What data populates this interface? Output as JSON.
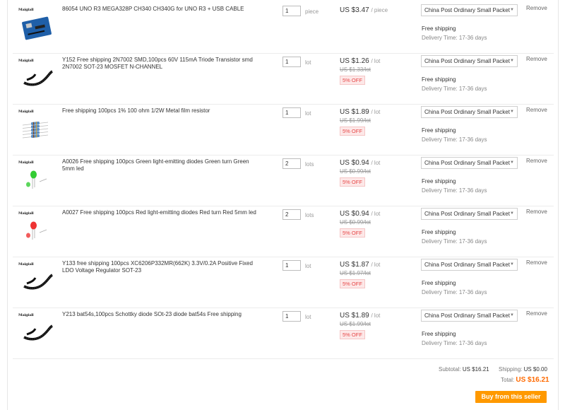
{
  "items": [
    {
      "brand": "Maigiall",
      "title": "86054 UNO R3 MEGA328P CH340 CH340G for UNO R3 + USB CABLE",
      "qty": "1",
      "unit": "piece",
      "price": "US $3.47",
      "per": "/ piece",
      "old_price": "",
      "discount": "",
      "shipping": "China Post Ordinary Small Packet",
      "free": "Free shipping",
      "delivery": "Delivery Time: 17-36 days",
      "remove": "Remove",
      "icon": "arduino-board"
    },
    {
      "brand": "Maigiall",
      "title": "Y152 Free shipping 2N7002 SMD,100pcs 60V 115mA Triode Transistor smd 2N7002 SOT-23 MOSFET N-CHANNEL",
      "qty": "1",
      "unit": "lot",
      "price": "US $1.26",
      "per": "/ lot",
      "old_price": "US $1.33/lot",
      "discount": "5% OFF",
      "shipping": "China Post Ordinary Small Packet",
      "free": "Free shipping",
      "delivery": "Delivery Time: 17-36 days",
      "remove": "Remove",
      "icon": "smd-tape"
    },
    {
      "brand": "Maigiall",
      "title": "Free shipping 100pcs 1% 100 ohm 1/2W Metal film resistor",
      "qty": "1",
      "unit": "lot",
      "price": "US $1.89",
      "per": "/ lot",
      "old_price": "US $1.99/lot",
      "discount": "5% OFF",
      "shipping": "China Post Ordinary Small Packet",
      "free": "Free shipping",
      "delivery": "Delivery Time: 17-36 days",
      "remove": "Remove",
      "icon": "resistors"
    },
    {
      "brand": "Maigiall",
      "title": "A0026 Free shipping 100pcs Green light-emitting diodes Green turn Green 5mm led",
      "qty": "2",
      "unit": "lots",
      "price": "US $0.94",
      "per": "/ lot",
      "old_price": "US $0.99/lot",
      "discount": "5% OFF",
      "shipping": "China Post Ordinary Small Packet",
      "free": "Free shipping",
      "delivery": "Delivery Time: 17-36 days",
      "remove": "Remove",
      "icon": "green-led",
      "led_color": "#33cc33"
    },
    {
      "brand": "Maigiall",
      "title": "A0027 Free shipping 100pcs Red light-emitting diodes Red turn Red 5mm led",
      "qty": "2",
      "unit": "lots",
      "price": "US $0.94",
      "per": "/ lot",
      "old_price": "US $0.99/lot",
      "discount": "5% OFF",
      "shipping": "China Post Ordinary Small Packet",
      "free": "Free shipping",
      "delivery": "Delivery Time: 17-36 days",
      "remove": "Remove",
      "icon": "red-led",
      "led_color": "#ee3333"
    },
    {
      "brand": "Maigiall",
      "title": "Y133 free shipping 100pcs XC6206P332MR(662K) 3.3V/0.2A Positive Fixed LDO Voltage Regulator SOT-23",
      "qty": "1",
      "unit": "lot",
      "price": "US $1.87",
      "per": "/ lot",
      "old_price": "US $1.97/lot",
      "discount": "5% OFF",
      "shipping": "China Post Ordinary Small Packet",
      "free": "Free shipping",
      "delivery": "Delivery Time: 17-36 days",
      "remove": "Remove",
      "icon": "smd-tape"
    },
    {
      "brand": "Maigiall",
      "title": "Y213 bat54s,100pcs Schottky diode SOt-23 diode bat54s Free shipping",
      "qty": "1",
      "unit": "lot",
      "price": "US $1.89",
      "per": "/ lot",
      "old_price": "US $1.99/lot",
      "discount": "5% OFF",
      "shipping": "China Post Ordinary Small Packet",
      "free": "Free shipping",
      "delivery": "Delivery Time: 17-36 days",
      "remove": "Remove",
      "icon": "smd-tape"
    }
  ],
  "summary": {
    "subtotal_label": "Subtotal:",
    "subtotal_value": "US $16.21",
    "shipping_label": "Shipping:",
    "shipping_value": "US $0.00",
    "total_label": "Total:",
    "total_value": "US $16.21"
  },
  "buy_button": "Buy from this seller",
  "colors": {
    "accent": "#ff9900",
    "total": "#ff6a00",
    "discount": "#e64545"
  }
}
